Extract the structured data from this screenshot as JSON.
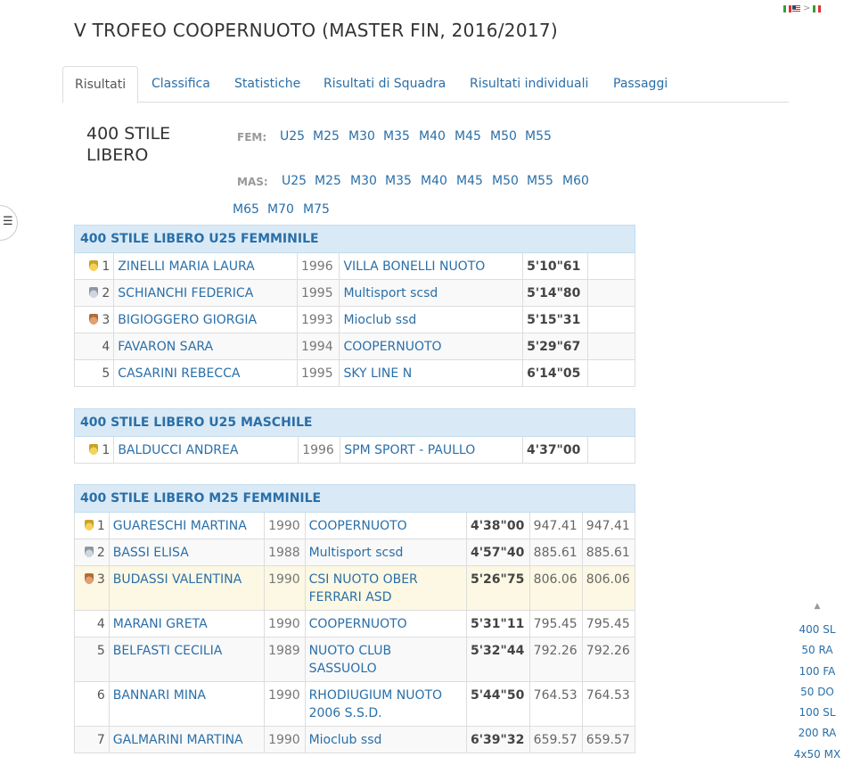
{
  "title": "V TROFEO COOPERNUOTO (MASTER FIN, 2016/2017)",
  "lang_sep": ">",
  "tabs": [
    "Risultati",
    "Classifica",
    "Statistiche",
    "Risultati di Squadra",
    "Risultati individuali",
    "Passaggi"
  ],
  "event": {
    "line1": "400 STILE",
    "line2": "LIBERO"
  },
  "fem_label": "FEM:",
  "mas_label": "MAS:",
  "fem_categories": [
    "U25",
    "M25",
    "M30",
    "M35",
    "M40",
    "M45",
    "M50",
    "M55"
  ],
  "mas_categories": [
    "U25",
    "M25",
    "M30",
    "M35",
    "M40",
    "M45",
    "M50",
    "M55",
    "M60",
    "M65",
    "M70",
    "M75"
  ],
  "table1": {
    "heading": "400 STILE LIBERO U25 FEMMINILE",
    "rows": [
      {
        "pos": "1",
        "medal": "gold",
        "name": "ZINELLI MARIA LAURA",
        "year": "1996",
        "club": "VILLA BONELLI NUOTO",
        "time": "5'10\"61"
      },
      {
        "pos": "2",
        "medal": "silver",
        "name": "SCHIANCHI FEDERICA",
        "year": "1995",
        "club": "Multisport scsd",
        "time": "5'14\"80"
      },
      {
        "pos": "3",
        "medal": "bronze",
        "name": "BIGIOGGERO GIORGIA",
        "year": "1993",
        "club": "Mioclub ssd",
        "time": "5'15\"31"
      },
      {
        "pos": "4",
        "medal": "",
        "name": "FAVARON SARA",
        "year": "1994",
        "club": "COOPERNUOTO",
        "time": "5'29\"67"
      },
      {
        "pos": "5",
        "medal": "",
        "name": "CASARINI REBECCA",
        "year": "1995",
        "club": "SKY LINE N",
        "time": "6'14\"05"
      }
    ]
  },
  "table2": {
    "heading": "400 STILE LIBERO U25 MASCHILE",
    "rows": [
      {
        "pos": "1",
        "medal": "gold",
        "name": "BALDUCCI ANDREA",
        "year": "1996",
        "club": "SPM SPORT - PAULLO",
        "time": "4'37\"00"
      }
    ]
  },
  "table3": {
    "heading": "400 STILE LIBERO M25 FEMMINILE",
    "rows": [
      {
        "pos": "1",
        "medal": "gold",
        "name": "GUARESCHI MARTINA",
        "year": "1990",
        "club": "COOPERNUOTO",
        "time": "4'38\"00",
        "pts1": "947.41",
        "pts2": "947.41"
      },
      {
        "pos": "2",
        "medal": "silver",
        "name": "BASSI ELISA",
        "year": "1988",
        "club": "Multisport scsd",
        "time": "4'57\"40",
        "pts1": "885.61",
        "pts2": "885.61"
      },
      {
        "pos": "3",
        "medal": "bronze",
        "name": "BUDASSI VALENTINA",
        "year": "1990",
        "club": "CSI NUOTO OBER FERRARI ASD",
        "time": "5'26\"75",
        "pts1": "806.06",
        "pts2": "806.06"
      },
      {
        "pos": "4",
        "medal": "",
        "name": "MARANI GRETA",
        "year": "1990",
        "club": "COOPERNUOTO",
        "time": "5'31\"11",
        "pts1": "795.45",
        "pts2": "795.45"
      },
      {
        "pos": "5",
        "medal": "",
        "name": "BELFASTI CECILIA",
        "year": "1989",
        "club": "NUOTO CLUB SASSUOLO",
        "time": "5'32\"44",
        "pts1": "792.26",
        "pts2": "792.26"
      },
      {
        "pos": "6",
        "medal": "",
        "name": "BANNARI MINA",
        "year": "1990",
        "club": "RHODIUGIUM NUOTO 2006 S.S.D.",
        "time": "5'44\"50",
        "pts1": "764.53",
        "pts2": "764.53"
      },
      {
        "pos": "7",
        "medal": "",
        "name": "GALMARINI MARTINA",
        "year": "1990",
        "club": "Mioclub ssd",
        "time": "6'39\"32",
        "pts1": "659.57",
        "pts2": "659.57"
      }
    ]
  },
  "sidenav": [
    "400 SL",
    "50 RA",
    "100 FA",
    "50 DO",
    "100 SL",
    "200 RA",
    "4x50 MX"
  ]
}
